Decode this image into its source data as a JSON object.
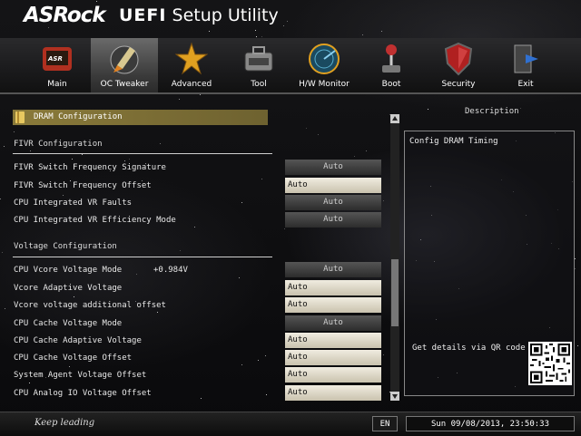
{
  "header": {
    "brand": "ASRock",
    "product_bold": "UEFI",
    "product_rest": " Setup Utility"
  },
  "nav": {
    "tabs": [
      {
        "label": "Main",
        "icon": "main-icon",
        "color": "#c0392b"
      },
      {
        "label": "OC Tweaker",
        "icon": "rocket-icon",
        "color": "#c8b070",
        "active": true
      },
      {
        "label": "Advanced",
        "icon": "star-icon",
        "color": "#e0a020"
      },
      {
        "label": "Tool",
        "icon": "toolbox-icon",
        "color": "#777777"
      },
      {
        "label": "H/W Monitor",
        "icon": "radar-icon",
        "color": "#2a7fa0"
      },
      {
        "label": "Boot",
        "icon": "joystick-icon",
        "color": "#c03030"
      },
      {
        "label": "Security",
        "icon": "shield-icon",
        "color": "#b02020"
      },
      {
        "label": "Exit",
        "icon": "exit-door-icon",
        "color": "#3060c0"
      }
    ]
  },
  "settings": {
    "selected_item": "DRAM Configuration",
    "section_fivr": "FIVR Configuration",
    "section_voltage": "Voltage Configuration",
    "rows": [
      {
        "label": "FIVR Switch Frequency Signature",
        "value": "Auto",
        "style": "dark"
      },
      {
        "label": "FIVR Switch Frequency Offset",
        "value": "Auto",
        "style": "light"
      },
      {
        "label": "CPU Integrated VR Faults",
        "value": "Auto",
        "style": "dark"
      },
      {
        "label": "CPU Integrated VR Efficiency Mode",
        "value": "Auto",
        "style": "dark"
      },
      {
        "label": "CPU Vcore Voltage Mode",
        "extra": "+0.984V",
        "value": "Auto",
        "style": "dark"
      },
      {
        "label": "Vcore Adaptive Voltage",
        "value": "Auto",
        "style": "light"
      },
      {
        "label": "Vcore voltage additional offset",
        "value": "Auto",
        "style": "light"
      },
      {
        "label": "CPU Cache Voltage Mode",
        "value": "Auto",
        "style": "dark"
      },
      {
        "label": "CPU Cache Adaptive Voltage",
        "value": "Auto",
        "style": "light"
      },
      {
        "label": "CPU Cache Voltage Offset",
        "value": "Auto",
        "style": "light"
      },
      {
        "label": "System Agent Voltage Offset",
        "value": "Auto",
        "style": "light"
      },
      {
        "label": "CPU Analog IO Voltage Offset",
        "value": "Auto",
        "style": "light"
      }
    ]
  },
  "description": {
    "title": "Description",
    "text": "Config DRAM Timing",
    "qr_text": "Get details via QR code"
  },
  "footer": {
    "slogan": "Keep leading",
    "language": "EN",
    "datetime": "Sun 09/08/2013, 23:50:33"
  }
}
